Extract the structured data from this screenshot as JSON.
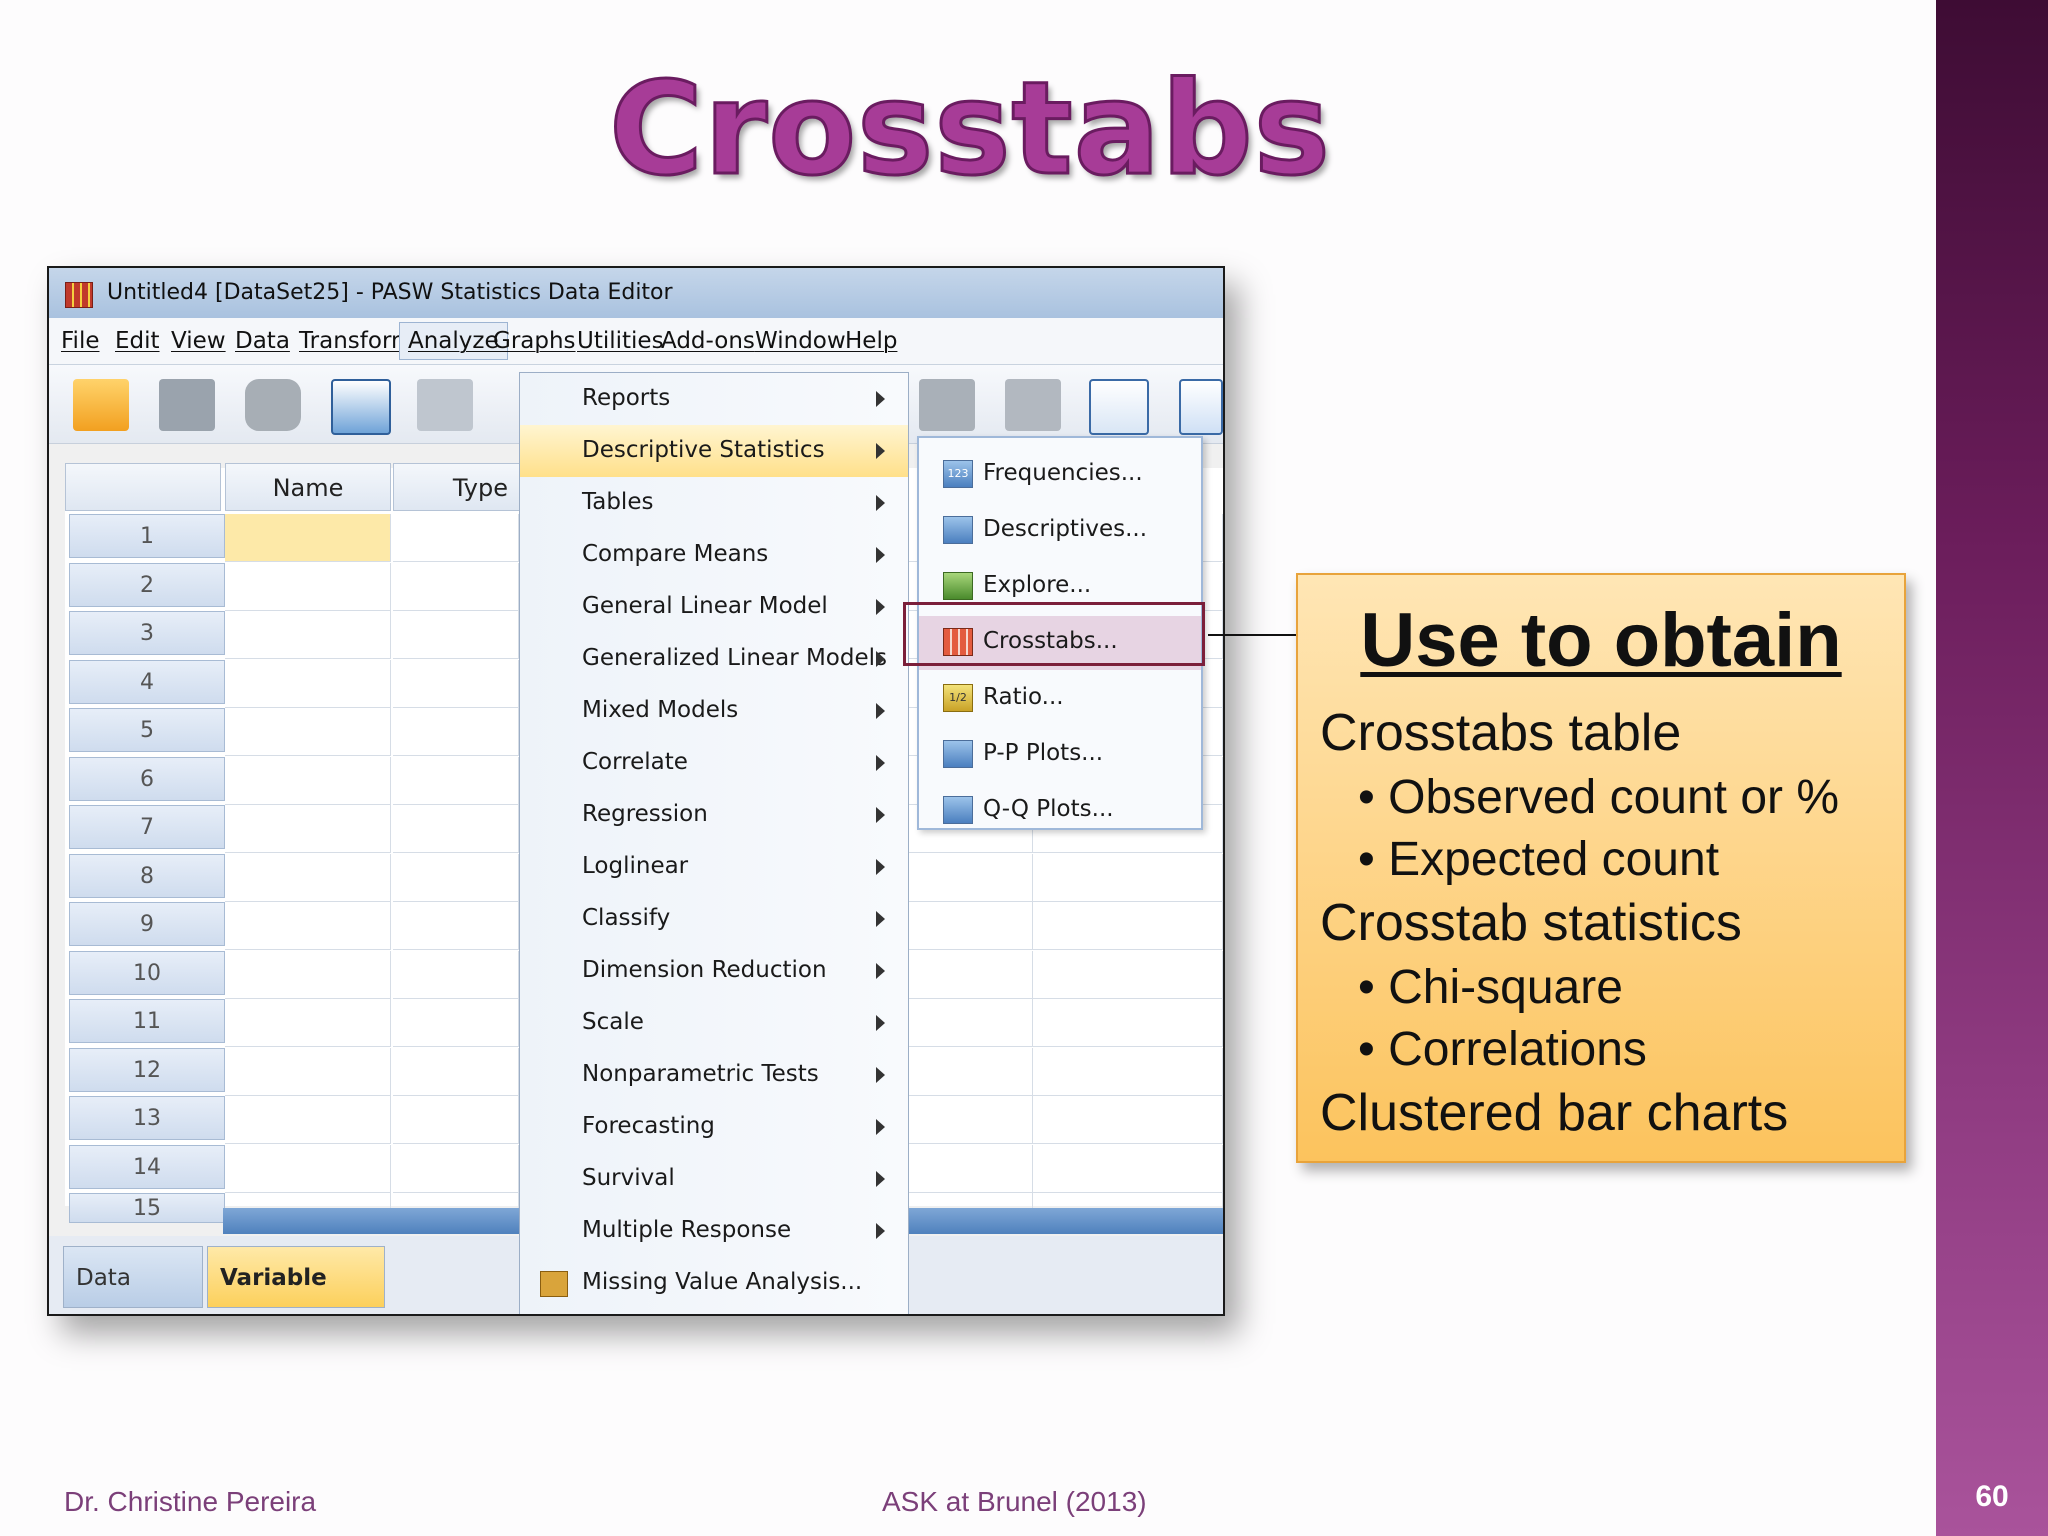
{
  "slide": {
    "title": "Crosstabs",
    "page_number": "60",
    "footer_left": "Dr. Christine Pereira",
    "footer_center": "ASK at Brunel (2013)"
  },
  "window": {
    "title": "Untitled4 [DataSet25] - PASW Statistics Data Editor",
    "menu": [
      "File",
      "Edit",
      "View",
      "Data",
      "Transform",
      "Analyze",
      "Graphs",
      "Utilities",
      "Add-ons",
      "Window",
      "Help"
    ],
    "active_menu": "Analyze",
    "columns": [
      "Name",
      "Type"
    ],
    "rows": [
      "1",
      "2",
      "3",
      "4",
      "5",
      "6",
      "7",
      "8",
      "9",
      "10",
      "11",
      "12",
      "13",
      "14",
      "15"
    ],
    "tabs": [
      "Data View",
      "Variable View"
    ],
    "active_tab": "Variable View"
  },
  "analyze_menu": {
    "items": [
      "Reports",
      "Descriptive Statistics",
      "Tables",
      "Compare Means",
      "General Linear Model",
      "Generalized Linear Models",
      "Mixed Models",
      "Correlate",
      "Regression",
      "Loglinear",
      "Classify",
      "Dimension Reduction",
      "Scale",
      "Nonparametric Tests",
      "Forecasting",
      "Survival",
      "Multiple Response",
      "Missing Value Analysis..."
    ],
    "highlighted": "Descriptive Statistics"
  },
  "descriptive_submenu": {
    "items": [
      "Frequencies...",
      "Descriptives...",
      "Explore...",
      "Crosstabs...",
      "Ratio...",
      "P-P Plots...",
      "Q-Q Plots..."
    ],
    "selected": "Crosstabs..."
  },
  "callout": {
    "heading": "Use to obtain",
    "lines": [
      {
        "text": "Crosstabs table",
        "level": 0
      },
      {
        "text": "• Observed count or %",
        "level": 1
      },
      {
        "text": "• Expected count",
        "level": 1
      },
      {
        "text": "Crosstab statistics",
        "level": 0
      },
      {
        "text": "• Chi-square",
        "level": 1
      },
      {
        "text": "• Correlations",
        "level": 1
      },
      {
        "text": "Clustered bar charts",
        "level": 0
      }
    ]
  },
  "colors": {
    "title": "#a73c97",
    "callout_bg": "#fcc35d",
    "highlight": "#ffe08a",
    "selection_border": "#7b1f3a"
  }
}
